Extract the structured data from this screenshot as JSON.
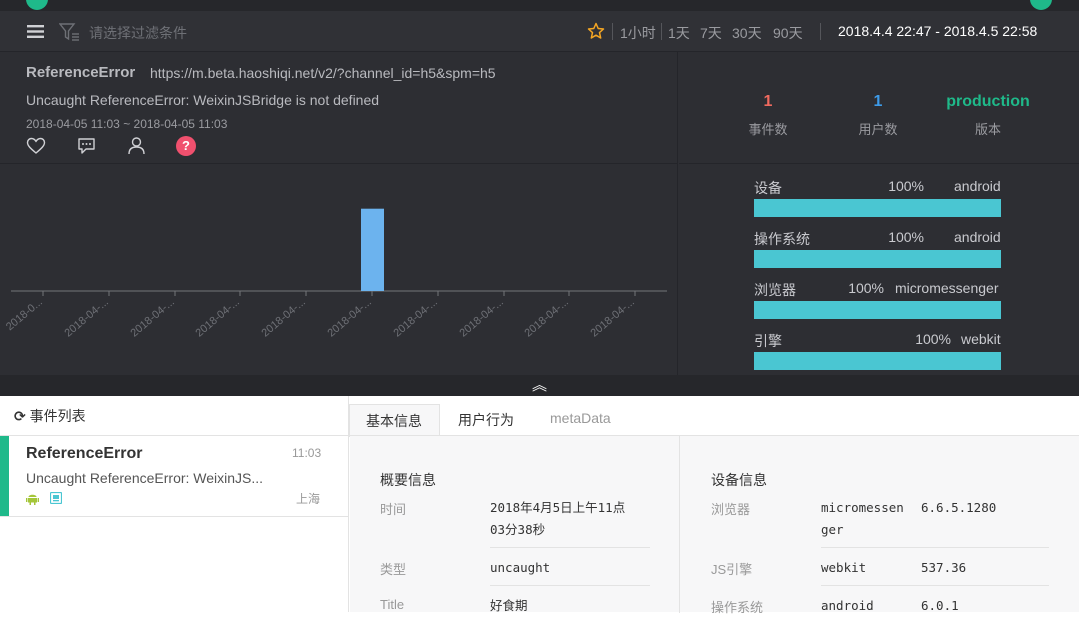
{
  "toolbar": {
    "filter_placeholder": "请选择过滤条件",
    "ranges": [
      "1小时",
      "1天",
      "7天",
      "30天",
      "90天"
    ],
    "date_range": "2018.4.4 22:47 - 2018.4.5 22:58"
  },
  "issue": {
    "type": "ReferenceError",
    "url": "https://m.beta.haoshiqi.net/v2/?channel_id=h5&spm=h5",
    "message": "Uncaught ReferenceError: WeixinJSBridge is not defined",
    "time_range": "2018-04-05 11:03 ~ 2018-04-05 11:03",
    "help_glyph": "?"
  },
  "stats": [
    {
      "value": "1",
      "label": "事件数",
      "color": "#f06a5f"
    },
    {
      "value": "1",
      "label": "用户数",
      "color": "#3d9be9"
    },
    {
      "value": "production",
      "label": "版本",
      "color": "#1fb98a"
    }
  ],
  "chart_data": {
    "type": "bar",
    "categories": [
      "2018-0...",
      "2018-04-...",
      "2018-04-...",
      "2018-04-...",
      "2018-04-...",
      "2018-04-...",
      "2018-04-...",
      "2018-04-...",
      "2018-04-...",
      "2018-04-..."
    ],
    "bar_category_index": 5,
    "values": [
      0,
      0,
      0,
      0,
      0,
      1,
      0,
      0,
      0,
      0
    ],
    "ylim": [
      0,
      1.3
    ],
    "bar_color": "#6cb3ee",
    "grid": false
  },
  "distribution": [
    {
      "label": "设备",
      "percent": "100%",
      "name": "android",
      "fraction": 1
    },
    {
      "label": "操作系统",
      "percent": "100%",
      "name": "android",
      "fraction": 1
    },
    {
      "label": "浏览器",
      "percent": "100%",
      "name": "micromessenger",
      "fraction": 1
    },
    {
      "label": "引擎",
      "percent": "100%",
      "name": "webkit",
      "fraction": 1
    }
  ],
  "collapse_glyph": "︽",
  "event_list": {
    "title": "事件列表",
    "refresh_glyph": "⟳",
    "items": [
      {
        "title": "ReferenceError",
        "time": "11:03",
        "message": "Uncaught ReferenceError: WeixinJS...",
        "location": "上海"
      }
    ]
  },
  "tabs": [
    "基本信息",
    "用户行为",
    "metaData"
  ],
  "overview": {
    "title": "概要信息",
    "rows": [
      {
        "label": "时间",
        "value": "2018年4月5日上午11点03分38秒"
      },
      {
        "label": "类型",
        "value": "uncaught"
      },
      {
        "label": "Title",
        "value": "好食期"
      }
    ]
  },
  "device": {
    "title": "设备信息",
    "rows": [
      {
        "label": "浏览器",
        "name": "micromessenger",
        "version": "6.6.5.1280"
      },
      {
        "label": "JS引擎",
        "name": "webkit",
        "version": "537.36"
      },
      {
        "label": "操作系统",
        "name": "android",
        "version": "6.0.1"
      }
    ]
  }
}
